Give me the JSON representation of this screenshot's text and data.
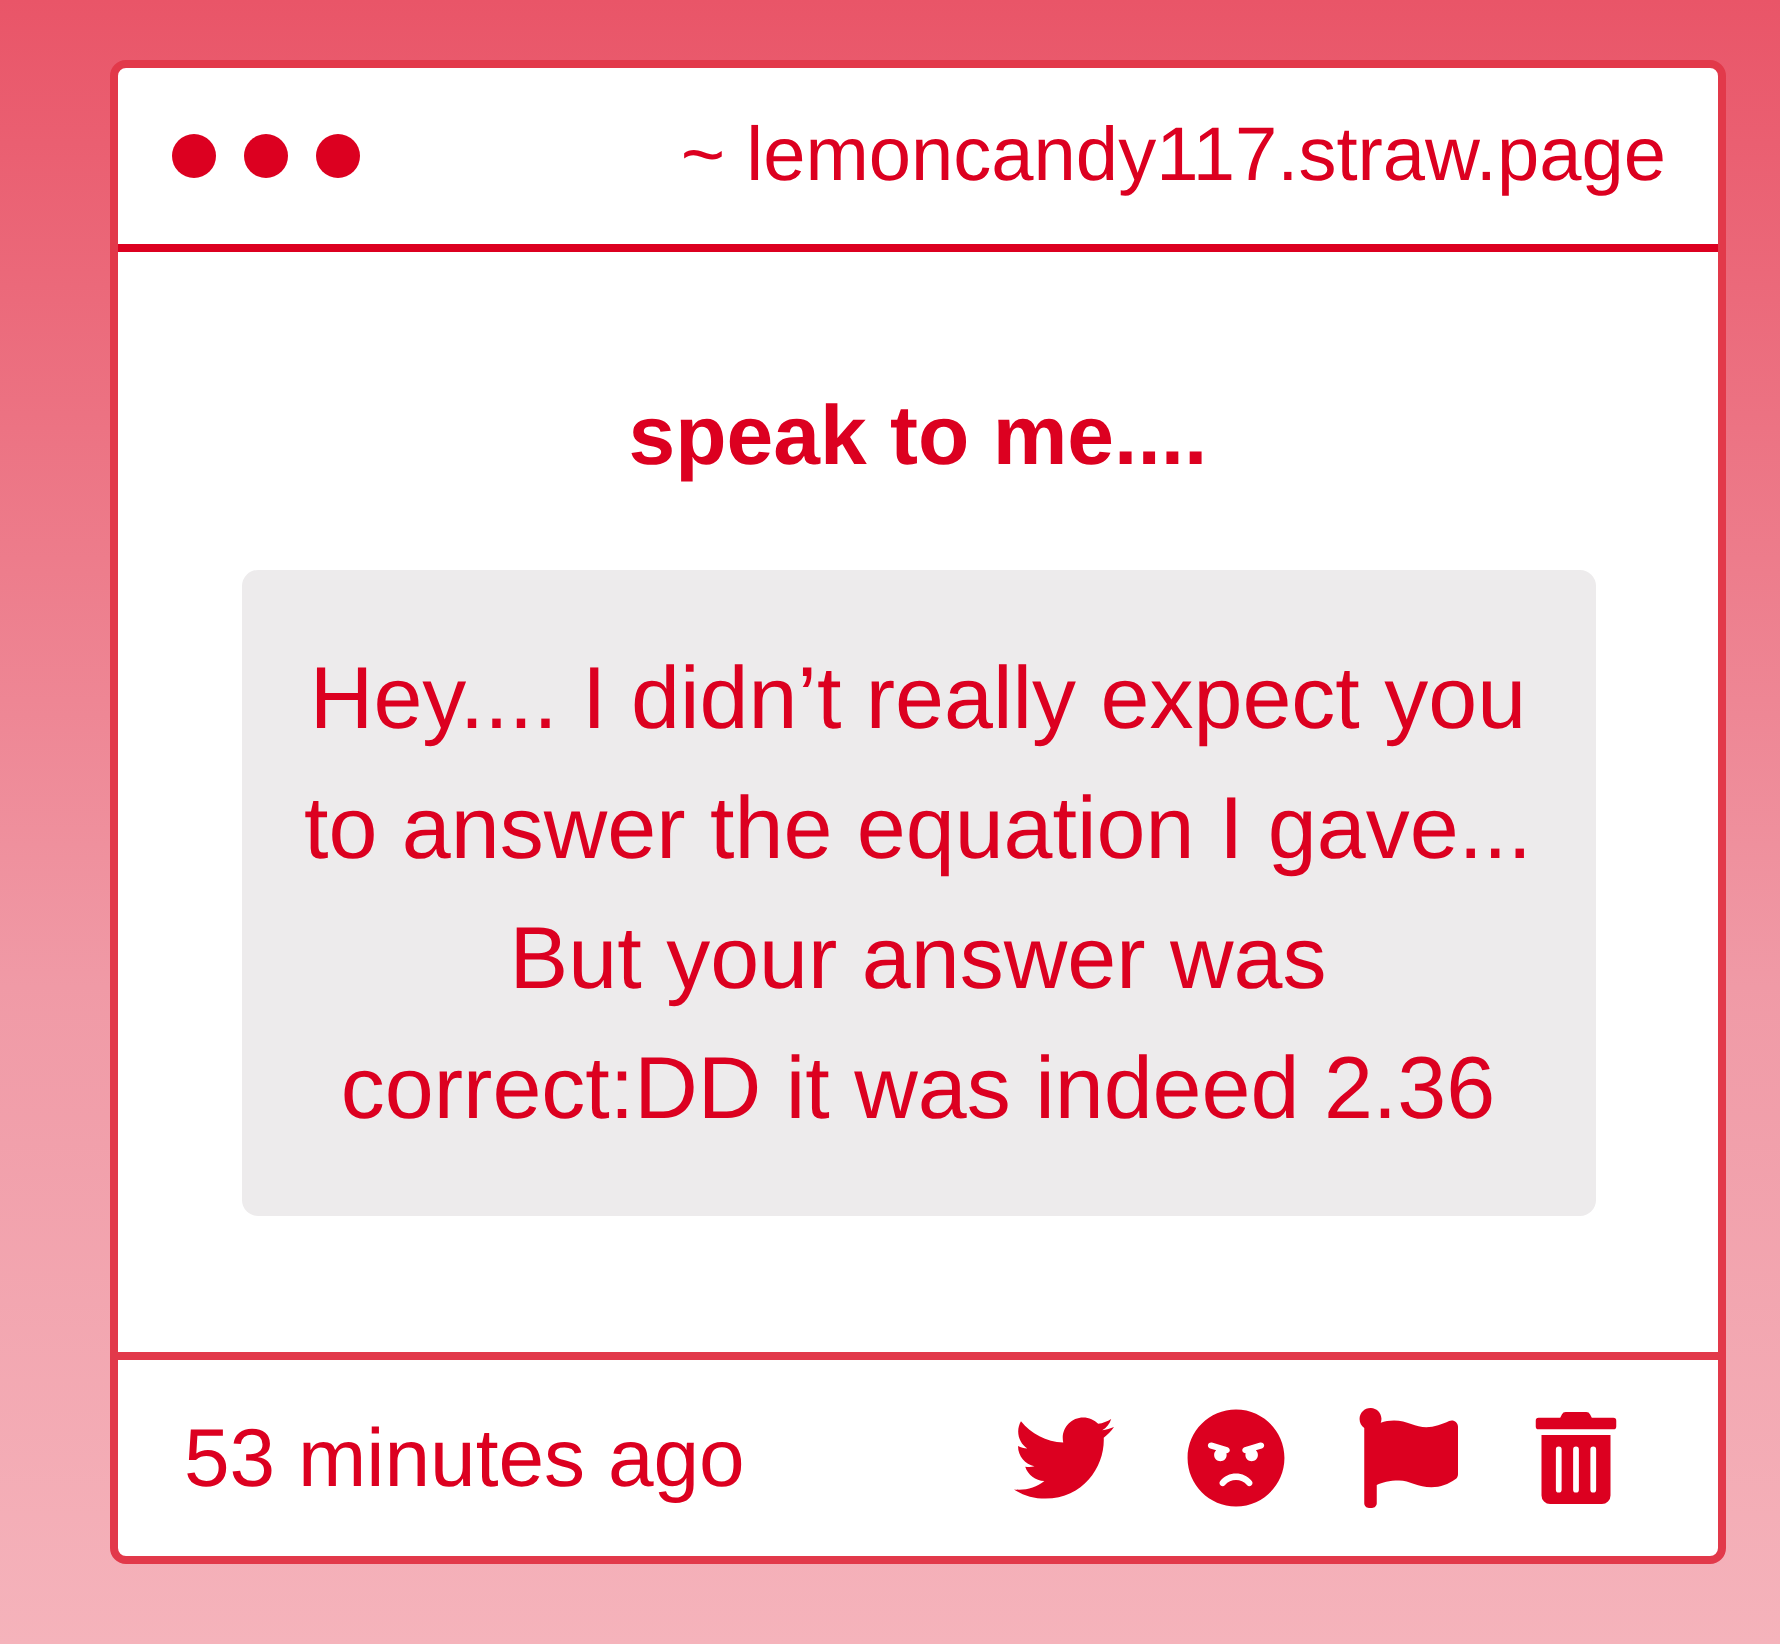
{
  "window": {
    "url": "~ lemoncandy117.straw.page"
  },
  "message": {
    "title": "speak to me....",
    "text": "Hey.... I didn’t really expect you to answer the equation I gave... But your answer was\ncorrect:DD it was indeed 2.36"
  },
  "footer": {
    "time": "53 minutes ago",
    "actions": [
      {
        "kind": "tweet"
      },
      {
        "kind": "react"
      },
      {
        "kind": "report"
      },
      {
        "kind": "delete"
      }
    ]
  }
}
